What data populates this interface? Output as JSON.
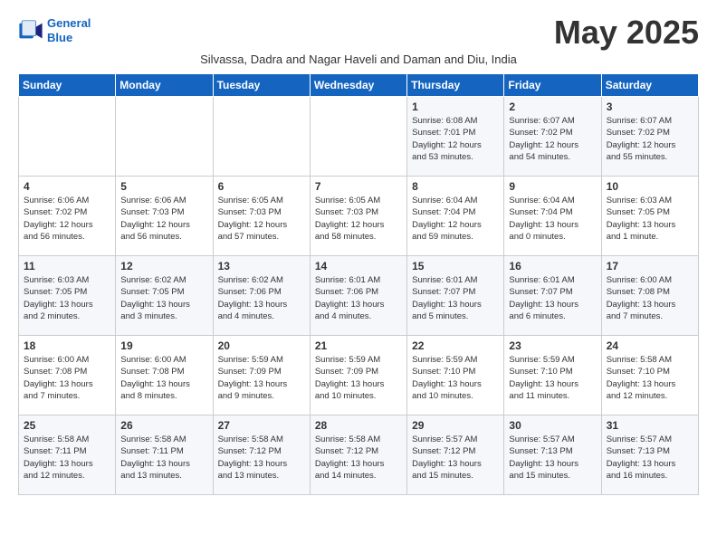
{
  "header": {
    "logo_line1": "General",
    "logo_line2": "Blue",
    "month_title": "May 2025",
    "subtitle": "Silvassa, Dadra and Nagar Haveli and Daman and Diu, India"
  },
  "weekdays": [
    "Sunday",
    "Monday",
    "Tuesday",
    "Wednesday",
    "Thursday",
    "Friday",
    "Saturday"
  ],
  "weeks": [
    [
      {
        "day": "",
        "info": ""
      },
      {
        "day": "",
        "info": ""
      },
      {
        "day": "",
        "info": ""
      },
      {
        "day": "",
        "info": ""
      },
      {
        "day": "1",
        "info": "Sunrise: 6:08 AM\nSunset: 7:01 PM\nDaylight: 12 hours\nand 53 minutes."
      },
      {
        "day": "2",
        "info": "Sunrise: 6:07 AM\nSunset: 7:02 PM\nDaylight: 12 hours\nand 54 minutes."
      },
      {
        "day": "3",
        "info": "Sunrise: 6:07 AM\nSunset: 7:02 PM\nDaylight: 12 hours\nand 55 minutes."
      }
    ],
    [
      {
        "day": "4",
        "info": "Sunrise: 6:06 AM\nSunset: 7:02 PM\nDaylight: 12 hours\nand 56 minutes."
      },
      {
        "day": "5",
        "info": "Sunrise: 6:06 AM\nSunset: 7:03 PM\nDaylight: 12 hours\nand 56 minutes."
      },
      {
        "day": "6",
        "info": "Sunrise: 6:05 AM\nSunset: 7:03 PM\nDaylight: 12 hours\nand 57 minutes."
      },
      {
        "day": "7",
        "info": "Sunrise: 6:05 AM\nSunset: 7:03 PM\nDaylight: 12 hours\nand 58 minutes."
      },
      {
        "day": "8",
        "info": "Sunrise: 6:04 AM\nSunset: 7:04 PM\nDaylight: 12 hours\nand 59 minutes."
      },
      {
        "day": "9",
        "info": "Sunrise: 6:04 AM\nSunset: 7:04 PM\nDaylight: 13 hours\nand 0 minutes."
      },
      {
        "day": "10",
        "info": "Sunrise: 6:03 AM\nSunset: 7:05 PM\nDaylight: 13 hours\nand 1 minute."
      }
    ],
    [
      {
        "day": "11",
        "info": "Sunrise: 6:03 AM\nSunset: 7:05 PM\nDaylight: 13 hours\nand 2 minutes."
      },
      {
        "day": "12",
        "info": "Sunrise: 6:02 AM\nSunset: 7:05 PM\nDaylight: 13 hours\nand 3 minutes."
      },
      {
        "day": "13",
        "info": "Sunrise: 6:02 AM\nSunset: 7:06 PM\nDaylight: 13 hours\nand 4 minutes."
      },
      {
        "day": "14",
        "info": "Sunrise: 6:01 AM\nSunset: 7:06 PM\nDaylight: 13 hours\nand 4 minutes."
      },
      {
        "day": "15",
        "info": "Sunrise: 6:01 AM\nSunset: 7:07 PM\nDaylight: 13 hours\nand 5 minutes."
      },
      {
        "day": "16",
        "info": "Sunrise: 6:01 AM\nSunset: 7:07 PM\nDaylight: 13 hours\nand 6 minutes."
      },
      {
        "day": "17",
        "info": "Sunrise: 6:00 AM\nSunset: 7:08 PM\nDaylight: 13 hours\nand 7 minutes."
      }
    ],
    [
      {
        "day": "18",
        "info": "Sunrise: 6:00 AM\nSunset: 7:08 PM\nDaylight: 13 hours\nand 7 minutes."
      },
      {
        "day": "19",
        "info": "Sunrise: 6:00 AM\nSunset: 7:08 PM\nDaylight: 13 hours\nand 8 minutes."
      },
      {
        "day": "20",
        "info": "Sunrise: 5:59 AM\nSunset: 7:09 PM\nDaylight: 13 hours\nand 9 minutes."
      },
      {
        "day": "21",
        "info": "Sunrise: 5:59 AM\nSunset: 7:09 PM\nDaylight: 13 hours\nand 10 minutes."
      },
      {
        "day": "22",
        "info": "Sunrise: 5:59 AM\nSunset: 7:10 PM\nDaylight: 13 hours\nand 10 minutes."
      },
      {
        "day": "23",
        "info": "Sunrise: 5:59 AM\nSunset: 7:10 PM\nDaylight: 13 hours\nand 11 minutes."
      },
      {
        "day": "24",
        "info": "Sunrise: 5:58 AM\nSunset: 7:10 PM\nDaylight: 13 hours\nand 12 minutes."
      }
    ],
    [
      {
        "day": "25",
        "info": "Sunrise: 5:58 AM\nSunset: 7:11 PM\nDaylight: 13 hours\nand 12 minutes."
      },
      {
        "day": "26",
        "info": "Sunrise: 5:58 AM\nSunset: 7:11 PM\nDaylight: 13 hours\nand 13 minutes."
      },
      {
        "day": "27",
        "info": "Sunrise: 5:58 AM\nSunset: 7:12 PM\nDaylight: 13 hours\nand 13 minutes."
      },
      {
        "day": "28",
        "info": "Sunrise: 5:58 AM\nSunset: 7:12 PM\nDaylight: 13 hours\nand 14 minutes."
      },
      {
        "day": "29",
        "info": "Sunrise: 5:57 AM\nSunset: 7:12 PM\nDaylight: 13 hours\nand 15 minutes."
      },
      {
        "day": "30",
        "info": "Sunrise: 5:57 AM\nSunset: 7:13 PM\nDaylight: 13 hours\nand 15 minutes."
      },
      {
        "day": "31",
        "info": "Sunrise: 5:57 AM\nSunset: 7:13 PM\nDaylight: 13 hours\nand 16 minutes."
      }
    ]
  ]
}
